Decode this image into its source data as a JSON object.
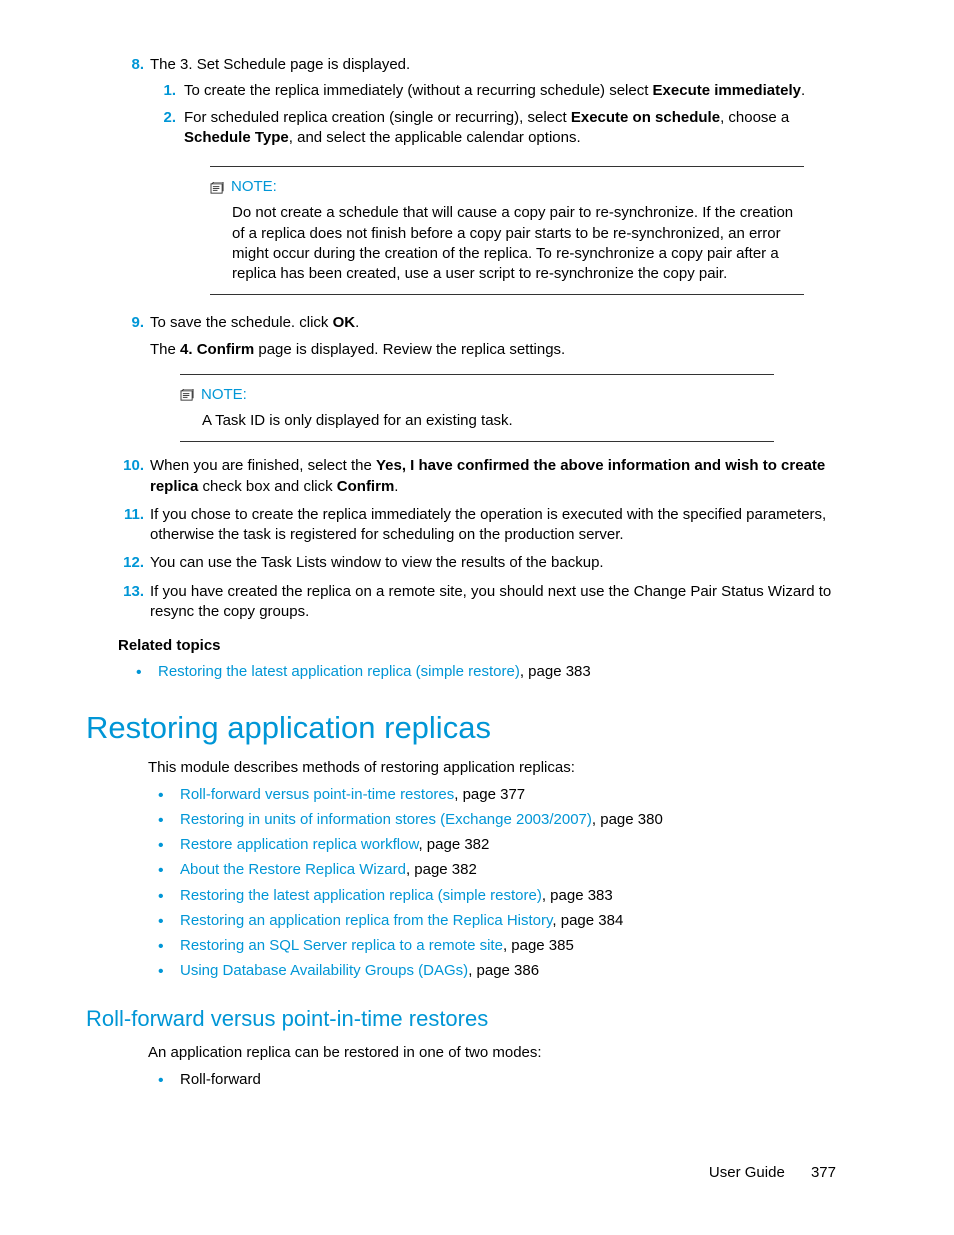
{
  "step8": {
    "num": "8",
    "text": "The 3. Set Schedule page is displayed.",
    "sub1": {
      "num": "1",
      "pre": "To create the replica immediately (without a recurring schedule) select ",
      "bold": "Execute immediately",
      "post": "."
    },
    "sub2": {
      "num": "2",
      "pre": "For scheduled replica creation (single or recurring), select ",
      "bold1": "Execute on schedule",
      "mid": ", choose a ",
      "bold2": "Schedule Type",
      "post": ", and select the applicable calendar options."
    }
  },
  "note1": {
    "label": "NOTE:",
    "text": "Do not create a schedule that will cause a copy pair to re-synchronize. If the creation of a replica does not finish before a copy pair starts to be re-synchronized, an error might occur during the creation of the replica. To re-synchronize a copy pair after a replica has been created, use a user script to re-synchronize the copy pair."
  },
  "step9": {
    "num": "9",
    "pre": "To save the schedule. click ",
    "bold": "OK",
    "post": ".",
    "line2pre": "The ",
    "line2bold": "4. Confirm",
    "line2post": " page is displayed. Review the replica settings."
  },
  "note2": {
    "label": "NOTE:",
    "text": "A Task ID is only displayed for an existing task."
  },
  "step10": {
    "num": "10",
    "pre": "When you are finished, select the ",
    "bold1": "Yes, I have confirmed the above information and wish to create replica",
    "mid": " check box and click ",
    "bold2": "Confirm",
    "post": "."
  },
  "step11": {
    "num": "11",
    "text": "If you chose to create the replica immediately the operation is executed with the specified parameters, otherwise the task is registered for scheduling on the production server."
  },
  "step12": {
    "num": "12",
    "text": "You can use the Task Lists window to view the results of the backup."
  },
  "step13": {
    "num": "13",
    "text": "If you have created the replica on a remote site, you should next use the Change Pair Status Wizard to resync the copy groups."
  },
  "related": {
    "heading": "Related topics",
    "item": {
      "link": "Restoring the latest application replica (simple restore)",
      "page": ", page 383"
    }
  },
  "section": {
    "h1": "Restoring application replicas",
    "intro": "This module describes methods of restoring application replicas:",
    "links": [
      {
        "link": "Roll-forward versus point-in-time restores",
        "page": ", page 377"
      },
      {
        "link": "Restoring in units of information stores (Exchange 2003/2007)",
        "page": ", page 380"
      },
      {
        "link": "Restore application replica workflow",
        "page": ", page 382"
      },
      {
        "link": "About the Restore Replica Wizard",
        "page": ", page 382"
      },
      {
        "link": "Restoring the latest application replica (simple restore)",
        "page": ", page 383"
      },
      {
        "link": "Restoring an application replica from the Replica History",
        "page": ", page 384"
      },
      {
        "link": "Restoring an SQL Server replica to a remote site",
        "page": ", page 385"
      },
      {
        "link": "Using Database Availability Groups (DAGs)",
        "page": ", page 386"
      }
    ]
  },
  "subsection": {
    "h2": "Roll-forward versus point-in-time restores",
    "intro": "An application replica can be restored in one of two modes:",
    "item": "Roll-forward"
  },
  "footer": {
    "label": "User Guide",
    "page": "377"
  }
}
